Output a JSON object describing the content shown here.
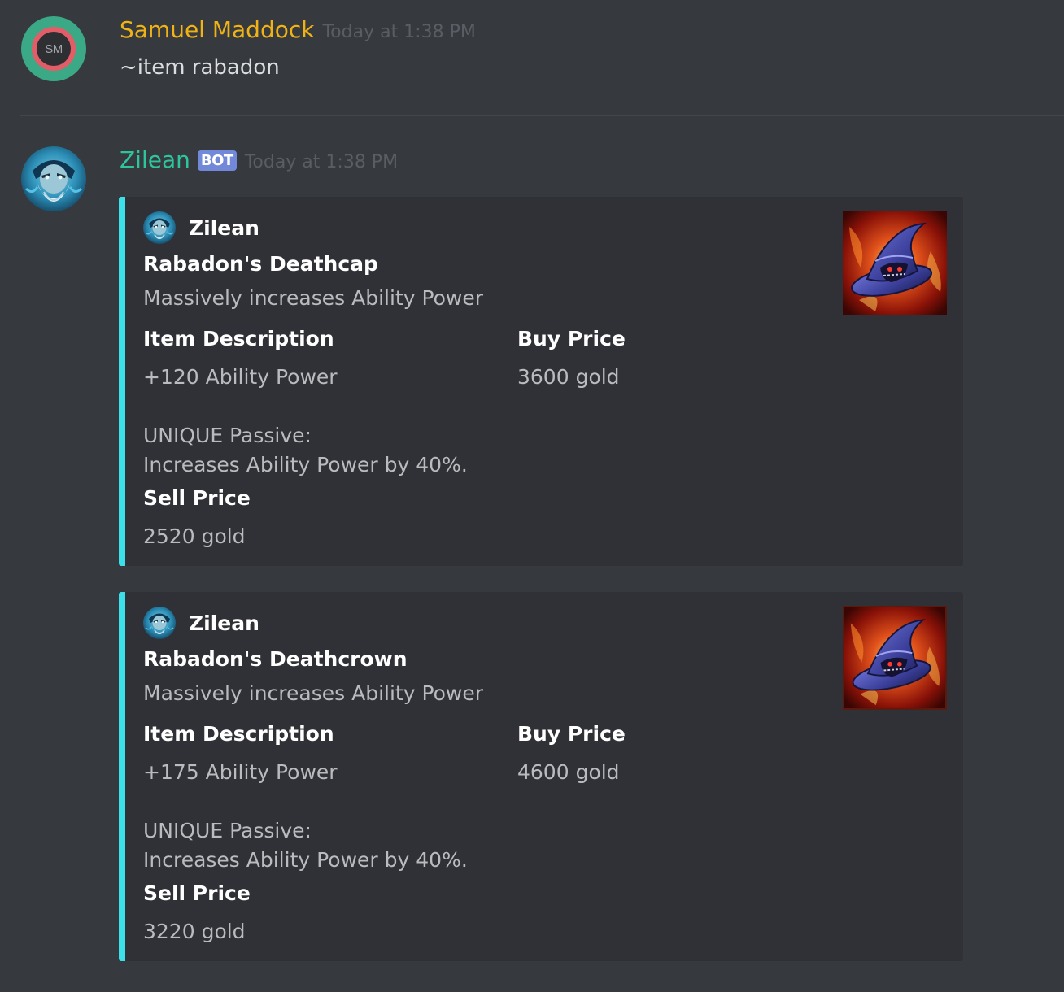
{
  "messages": [
    {
      "author": "Samuel Maddock",
      "author_color": "#f0b316",
      "avatar_initials": "SM",
      "timestamp": "Today at 1:38 PM",
      "content": "~item rabadon"
    },
    {
      "author": "Zilean",
      "author_color": "#2ec49c",
      "badge": "BOT",
      "timestamp": "Today at 1:38 PM",
      "embeds": [
        {
          "accent_color": "#3be0e9",
          "author_name": "Zilean",
          "title": "Rabadon's Deathcap",
          "description": "Massively increases Ability Power",
          "fields": [
            {
              "name": "Item Description",
              "value_lines": [
                "+120 Ability Power",
                "",
                "UNIQUE Passive:",
                "Increases Ability Power by 40%."
              ]
            },
            {
              "name": "Buy Price",
              "value": "3600 gold"
            },
            {
              "name": "Sell Price",
              "value": "2520 gold"
            }
          ],
          "thumbnail": "rabadons-deathcap-icon"
        },
        {
          "accent_color": "#3be0e9",
          "author_name": "Zilean",
          "title": "Rabadon's Deathcrown",
          "description": "Massively increases Ability Power",
          "fields": [
            {
              "name": "Item Description",
              "value_lines": [
                "+175 Ability Power",
                "",
                "UNIQUE Passive:",
                "Increases Ability Power by 40%."
              ]
            },
            {
              "name": "Buy Price",
              "value": "4600 gold"
            },
            {
              "name": "Sell Price",
              "value": "3220 gold"
            }
          ],
          "thumbnail": "rabadons-deathcrown-icon"
        }
      ]
    }
  ]
}
